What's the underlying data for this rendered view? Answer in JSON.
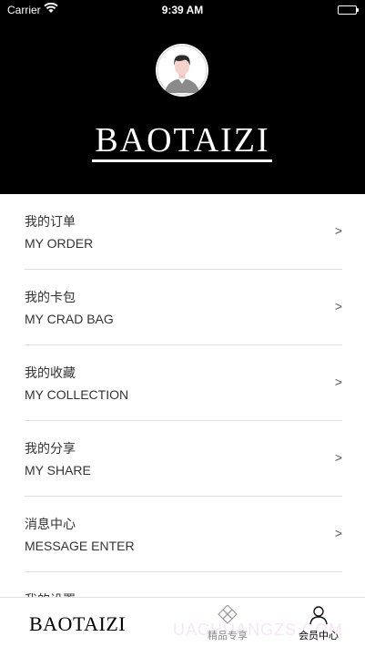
{
  "status_bar": {
    "carrier": "Carrier",
    "time": "9:39 AM",
    "wifi_icon": "wifi-icon",
    "battery_icon": "battery-icon"
  },
  "header": {
    "avatar_icon": "user-avatar-icon",
    "brand": "BAOTAIZI",
    "background": "#000000"
  },
  "menu": [
    {
      "zh": "我的订单",
      "en": "MY ORDER",
      "chevron": ">"
    },
    {
      "zh": "我的卡包",
      "en": "MY CRAD BAG",
      "chevron": ">"
    },
    {
      "zh": "我的收藏",
      "en": "MY COLLECTION",
      "chevron": ">"
    },
    {
      "zh": "我的分享",
      "en": "MY SHARE",
      "chevron": ">"
    },
    {
      "zh": "消息中心",
      "en": "MESSAGE ENTER",
      "chevron": ">"
    },
    {
      "zh": "我的设置",
      "en": "",
      "chevron": ""
    }
  ],
  "tabbar": {
    "brand": "BAOTAIZI",
    "tabs": [
      {
        "label": "精品专享",
        "icon": "diamond-icon",
        "active": false
      },
      {
        "label": "会员中心",
        "icon": "person-icon",
        "active": true
      }
    ],
    "watermark": "UACHUANGZS.COM"
  }
}
